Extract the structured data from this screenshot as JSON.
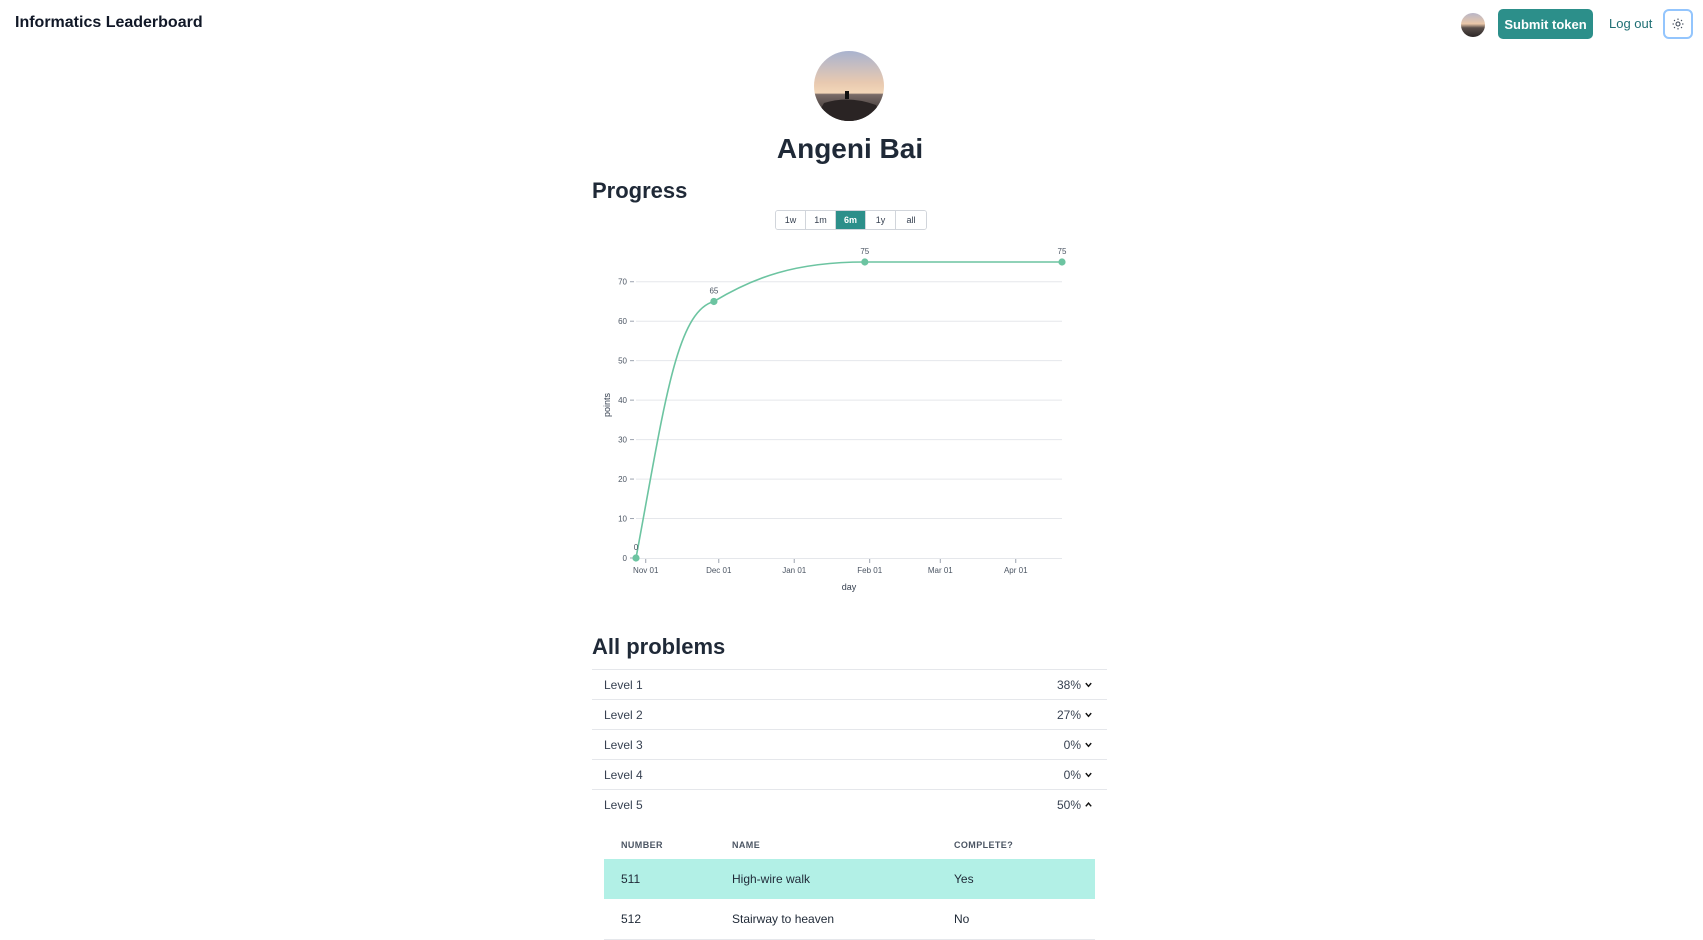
{
  "app": {
    "title": "Informatics Leaderboard"
  },
  "nav": {
    "submit_label": "Submit token",
    "logout_label": "Log out",
    "theme_icon": "sun-icon"
  },
  "profile": {
    "name": "Angeni Bai"
  },
  "progress": {
    "title": "Progress",
    "ranges": [
      {
        "label": "1w",
        "active": false
      },
      {
        "label": "1m",
        "active": false
      },
      {
        "label": "6m",
        "active": true
      },
      {
        "label": "1y",
        "active": false
      },
      {
        "label": "all",
        "active": false
      }
    ]
  },
  "chart_data": {
    "type": "line",
    "xlabel": "day",
    "ylabel": "points",
    "x_ticks": [
      "Nov 01",
      "Dec 01",
      "Jan 01",
      "Feb 01",
      "Mar 01",
      "Apr 01"
    ],
    "y_ticks": [
      0,
      10,
      20,
      30,
      40,
      50,
      60,
      70
    ],
    "ylim": [
      0,
      75
    ],
    "grid": true,
    "color": "#6cc4a1",
    "points": [
      {
        "x": "2023-10-28",
        "y": 0,
        "label": "0"
      },
      {
        "x": "2023-11-29",
        "y": 65,
        "label": "65"
      },
      {
        "x": "2024-01-30",
        "y": 75,
        "label": "75"
      },
      {
        "x": "2024-04-20",
        "y": 75,
        "label": "75"
      }
    ]
  },
  "problems": {
    "title": "All problems",
    "levels": [
      {
        "label": "Level 1",
        "percent": "38%",
        "expanded": false
      },
      {
        "label": "Level 2",
        "percent": "27%",
        "expanded": false
      },
      {
        "label": "Level 3",
        "percent": "0%",
        "expanded": false
      },
      {
        "label": "Level 4",
        "percent": "0%",
        "expanded": false
      },
      {
        "label": "Level 5",
        "percent": "50%",
        "expanded": true
      }
    ],
    "table": {
      "headers": [
        "NUMBER",
        "NAME",
        "COMPLETE?"
      ],
      "rows": [
        {
          "number": "511",
          "name": "High-wire walk",
          "complete": "Yes"
        },
        {
          "number": "512",
          "name": "Stairway to heaven",
          "complete": "No"
        }
      ]
    }
  }
}
